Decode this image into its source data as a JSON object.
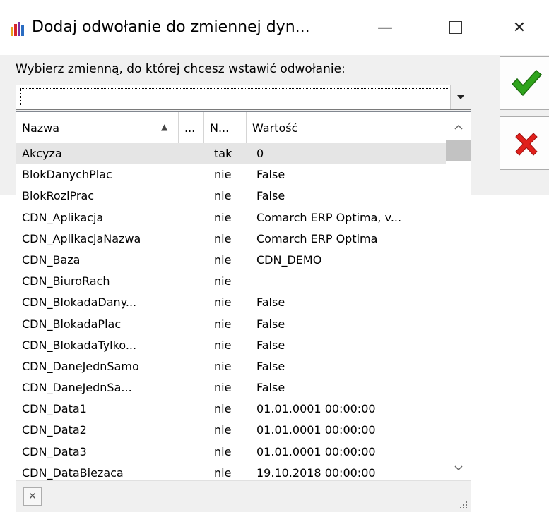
{
  "window": {
    "title": "Dodaj odwołanie do zmiennej dyn...",
    "min_glyph": "—",
    "close_glyph": "✕"
  },
  "instruction": "Wybierz zmienną, do której chcesz wstawić odwołanie:",
  "combo": {
    "value": ""
  },
  "buttons": {
    "ok_icon": "checkmark-icon",
    "cancel_icon": "cross-icon",
    "ok_color": "#2fa41c",
    "cancel_color": "#e0201b"
  },
  "columns": {
    "name": "Nazwa",
    "dots": "...",
    "n": "N...",
    "value": "Wartość"
  },
  "rows": [
    {
      "name": "Akcyza",
      "n": "tak",
      "value": "0"
    },
    {
      "name": "BlokDanychPlac",
      "n": "nie",
      "value": "False"
    },
    {
      "name": "BlokRozlPrac",
      "n": "nie",
      "value": "False"
    },
    {
      "name": "CDN_Aplikacja",
      "n": "nie",
      "value": "Comarch ERP Optima, v..."
    },
    {
      "name": "CDN_AplikacjaNazwa",
      "n": "nie",
      "value": "Comarch ERP Optima"
    },
    {
      "name": "CDN_Baza",
      "n": "nie",
      "value": "CDN_DEMO"
    },
    {
      "name": "CDN_BiuroRach",
      "n": "nie",
      "value": ""
    },
    {
      "name": "CDN_BlokadaDany...",
      "n": "nie",
      "value": "False"
    },
    {
      "name": "CDN_BlokadaPlac",
      "n": "nie",
      "value": "False"
    },
    {
      "name": "CDN_BlokadaTylko...",
      "n": "nie",
      "value": "False"
    },
    {
      "name": "CDN_DaneJednSamo",
      "n": "nie",
      "value": "False"
    },
    {
      "name": "CDN_DaneJednSa...",
      "n": "nie",
      "value": "False"
    },
    {
      "name": "CDN_Data1",
      "n": "nie",
      "value": "01.01.0001 00:00:00"
    },
    {
      "name": "CDN_Data2",
      "n": "nie",
      "value": "01.01.0001 00:00:00"
    },
    {
      "name": "CDN_Data3",
      "n": "nie",
      "value": "01.01.0001 00:00:00"
    },
    {
      "name": "CDN_DataBiezaca",
      "n": "nie",
      "value": "19.10.2018 00:00:00"
    }
  ],
  "selected_row": 0,
  "footer": {
    "clear_glyph": "✕"
  }
}
